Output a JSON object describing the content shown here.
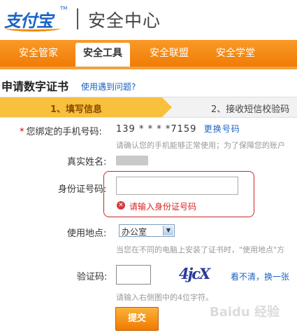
{
  "header": {
    "logo_text": "支付宝",
    "logo_tm": "TM",
    "title": "安全中心"
  },
  "nav": {
    "tabs": [
      {
        "label": "安全管家",
        "active": false
      },
      {
        "label": "安全工具",
        "active": true
      },
      {
        "label": "安全联盟",
        "active": false
      },
      {
        "label": "安全学堂",
        "active": false
      }
    ]
  },
  "page": {
    "title": "申请数字证书",
    "help_link": "使用遇到问题?"
  },
  "steps": {
    "step1": "1、填写信息",
    "step2": "2、接收短信校验码"
  },
  "form": {
    "phone_label": "您绑定的手机号码:",
    "phone_value": "139 * * * *7159",
    "phone_change": "更换号码",
    "phone_hint": "请确认您的手机能够正常使用；为了保障您的账户",
    "name_label": "真实姓名:",
    "id_label": "身份证号码:",
    "id_value": "",
    "id_error": "请输入身份证号码",
    "location_label": "使用地点:",
    "location_value": "办公室",
    "location_hint": "当您在不同的电脑上安装了证书时，\"使用地点\"方",
    "captcha_label": "验证码:",
    "captcha_image_text": "4jcX",
    "captcha_refresh": "看不清，换一张",
    "captcha_hint": "请输入右侧图中的4位字符。",
    "submit": "提交"
  },
  "watermark": "Baidu 经验",
  "colors": {
    "brand_orange": "#f07c05",
    "brand_blue": "#1a64c8",
    "step_active": "#f8c03c",
    "error_red": "#c82828"
  }
}
